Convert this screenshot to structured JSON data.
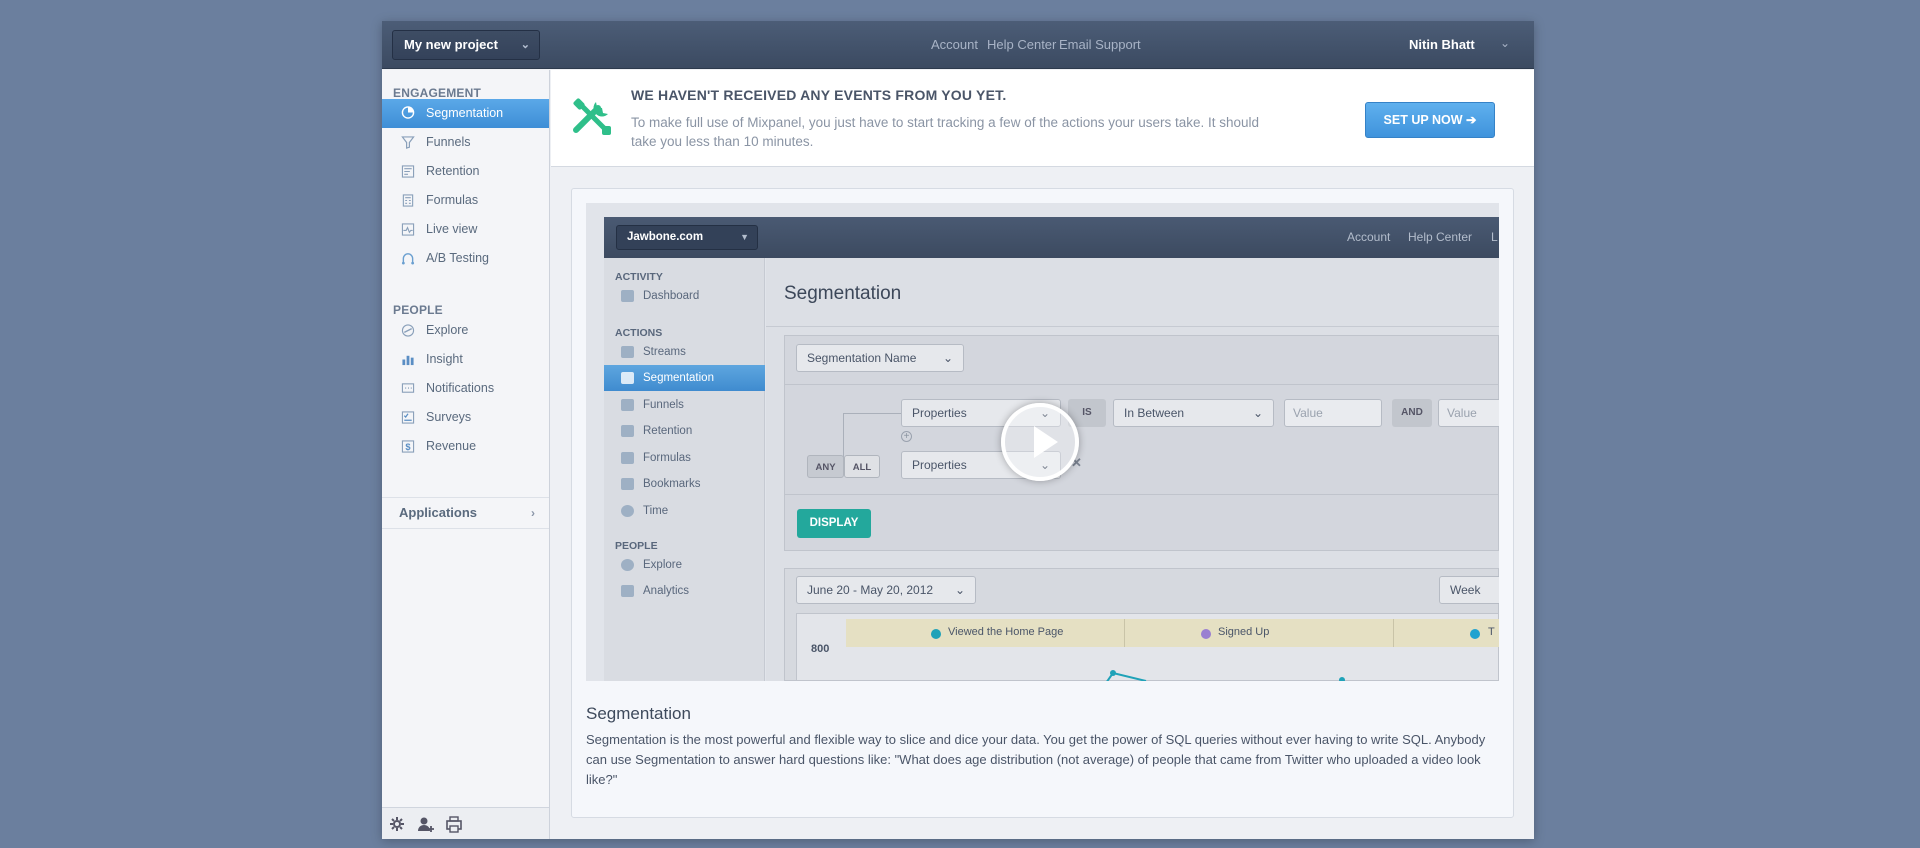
{
  "topbar": {
    "project": "My new project",
    "links": [
      "Account",
      "Help Center",
      "Email Support"
    ],
    "user": "Nitin Bhatt"
  },
  "sidebar": {
    "engagement_title": "ENGAGEMENT",
    "engagement_items": [
      "Segmentation",
      "Funnels",
      "Retention",
      "Formulas",
      "Live view",
      "A/B Testing"
    ],
    "people_title": "PEOPLE",
    "people_items": [
      "Explore",
      "Insight",
      "Notifications",
      "Surveys",
      "Revenue"
    ],
    "applications": "Applications",
    "active_item": "Segmentation"
  },
  "banner": {
    "title": "WE HAVEN'T RECEIVED ANY EVENTS FROM YOU YET.",
    "text": "To make full use of Mixpanel, you just have to start tracking a few of the actions your users take. It should take you less than 10 minutes.",
    "button": "SET UP NOW ➔"
  },
  "feature": {
    "title": "Segmentation",
    "description": "Segmentation is the most powerful and flexible way to slice and dice your data. You get the power of SQL queries without ever having to write SQL. Anybody can use Segmentation to answer hard questions like: \"What does age distribution (not average) of people that came from Twitter who uploaded a video look like?\""
  },
  "video": {
    "project": "Jawbone.com",
    "top_links": [
      "Account",
      "Help Center",
      "L"
    ],
    "activity_title": "ACTIVITY",
    "activity_items": [
      "Dashboard"
    ],
    "actions_title": "ACTIONS",
    "actions_items": [
      "Streams",
      "Segmentation",
      "Funnels",
      "Retention",
      "Formulas",
      "Bookmarks",
      "Time"
    ],
    "people_title": "PEOPLE",
    "people_items": [
      "Explore",
      "Analytics"
    ],
    "heading": "Segmentation",
    "segmentation_name": "Segmentation Name",
    "properties": "Properties",
    "is": "IS",
    "in_between": "In Between",
    "value": "Value",
    "and": "AND",
    "any": "ANY",
    "all": "ALL",
    "display": "DISPLAY",
    "date_range": "June 20 - May 20, 2012",
    "week": "Week",
    "y_tick": "800",
    "legend": [
      "Viewed the Home Page",
      "Signed Up",
      "T"
    ],
    "legend_colors": [
      "#1fa2b8",
      "#9a7fd1",
      "#1fa2d0"
    ]
  },
  "colors": {
    "accent": "#4a9de0",
    "background": "#6b7f9e",
    "tools_icon": "#2fbf8a"
  }
}
